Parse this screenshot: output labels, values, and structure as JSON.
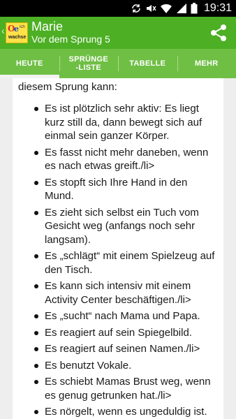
{
  "status_bar": {
    "time": "19:31",
    "icons": [
      "sync-icon",
      "mute-icon",
      "wifi-icon",
      "signal-icon",
      "battery-icon"
    ]
  },
  "action_bar": {
    "logo_text": {
      "o": "O",
      "e": "e",
      "ich": "ich",
      "wachse": "wachse"
    },
    "title": "Marie",
    "subtitle": "Vor dem Sprung 5",
    "share_icon": "share-icon"
  },
  "tabs": [
    {
      "label": "HEUTE",
      "active": true
    },
    {
      "label": "SPRÜNGE\n-LISTE",
      "active": false
    },
    {
      "label": "TABELLE",
      "active": false
    },
    {
      "label": "MEHR",
      "active": false
    }
  ],
  "content": {
    "intro": "diesem Sprung kann:",
    "items": [
      "Es ist plötzlich sehr aktiv: Es liegt kurz still da, dann bewegt sich auf einmal sein ganzer Körper.",
      "Es fasst nicht mehr daneben, wenn es nach etwas greift./li>",
      "Es stopft sich Ihre Hand in den Mund.",
      "Es zieht sich selbst ein Tuch vom Gesicht weg (anfangs noch sehr langsam).",
      "Es „schlägt“ mit einem Spielzeug auf den Tisch.",
      "Es kann sich intensiv mit einem Activity Center beschäftigen./li>",
      "Es „sucht“ nach Mama und Papa.",
      "Es reagiert auf sein Spiegelbild.",
      "Es reagiert auf seinen Namen./li>",
      "Es benutzt Vokale.",
      "Es schiebt Mamas Brust weg, wenn es genug getrunken hat./li>",
      "Es nörgelt, wenn es ungeduldig ist."
    ]
  },
  "colors": {
    "action_bar": "#4caf24",
    "tab_bar": "#6fbf45",
    "status_bar": "#000000",
    "page_bg": "#eeeeee"
  }
}
